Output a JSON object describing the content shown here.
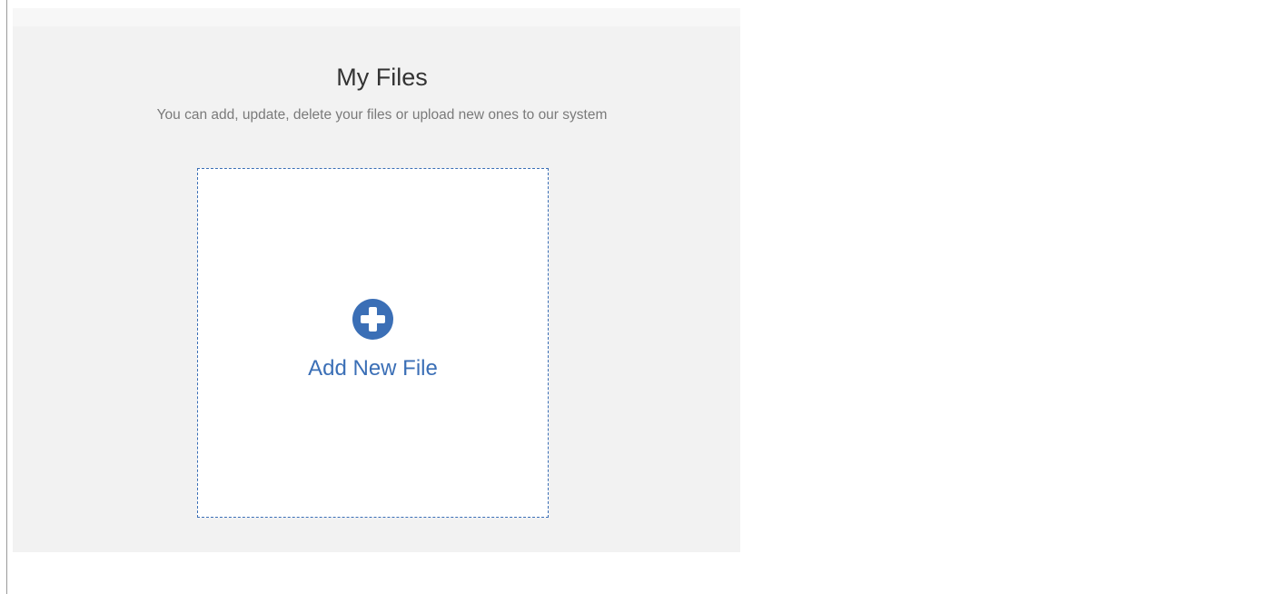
{
  "page": {
    "title": "My Files",
    "subtitle": "You can add, update, delete your files or upload new ones to our system"
  },
  "dropzone": {
    "label": "Add New File",
    "icon": "plus-circle-icon"
  },
  "colors": {
    "accent": "#3b6fb6",
    "panel_bg": "#f2f2f2",
    "title_text": "#333333",
    "subtitle_text": "#7a7a7a"
  }
}
